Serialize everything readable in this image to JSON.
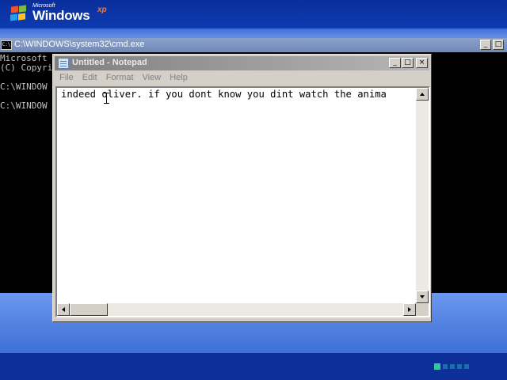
{
  "desktop": {
    "logo": {
      "microsoft": "Microsoft",
      "windows": "Windows",
      "xp": "xp"
    },
    "progress": {
      "steps": 5,
      "active": 1
    }
  },
  "cmd": {
    "title": "C:\\WINDOWS\\system32\\cmd.exe",
    "icon_label": "C:\\",
    "lines": [
      "Microsoft",
      "(C) Copyri",
      "C:\\WINDOW",
      "C:\\WINDOW"
    ],
    "buttons": {
      "minimize": "_",
      "maximize": "□"
    }
  },
  "notepad": {
    "title": "Untitled - Notepad",
    "menu": [
      "File",
      "Edit",
      "Format",
      "View",
      "Help"
    ],
    "buttons": {
      "minimize": "_",
      "maximize": "□",
      "close": "×"
    },
    "text": "indeed oliver. if you dont know you dint watch the anima"
  }
}
